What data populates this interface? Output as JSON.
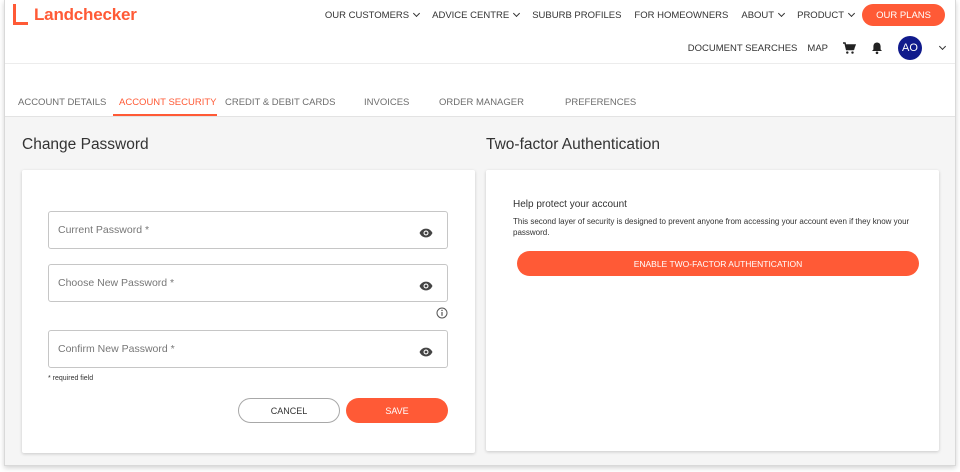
{
  "brand": {
    "name": "Landchecker",
    "accent": "#ff5a36",
    "avatar_bg": "#101a8c"
  },
  "topnav": {
    "items": [
      {
        "label": "OUR CUSTOMERS",
        "dropdown": true
      },
      {
        "label": "ADVICE CENTRE",
        "dropdown": true
      },
      {
        "label": "SUBURB PROFILES",
        "dropdown": false
      },
      {
        "label": "FOR HOMEOWNERS",
        "dropdown": false
      },
      {
        "label": "ABOUT",
        "dropdown": true
      },
      {
        "label": "PRODUCT",
        "dropdown": true
      }
    ],
    "cta": "OUR PLANS"
  },
  "subnav": {
    "document_searches": "DOCUMENT SEARCHES",
    "map": "MAP",
    "cart_icon": "cart-icon",
    "bell_icon": "bell-icon",
    "avatar_initials": "AO"
  },
  "tabs": [
    {
      "label": "ACCOUNT DETAILS",
      "active": false
    },
    {
      "label": "ACCOUNT SECURITY",
      "active": true
    },
    {
      "label": "CREDIT & DEBIT CARDS",
      "active": false
    },
    {
      "label": "INVOICES",
      "active": false
    },
    {
      "label": "ORDER MANAGER",
      "active": false
    },
    {
      "label": "PREFERENCES",
      "active": false
    }
  ],
  "change_password": {
    "title": "Change Password",
    "current_placeholder": "Current Password *",
    "new_placeholder": "Choose New Password *",
    "confirm_placeholder": "Confirm New Password *",
    "required_note": "* required field",
    "cancel_label": "CANCEL",
    "save_label": "SAVE"
  },
  "two_factor": {
    "title": "Two-factor Authentication",
    "heading": "Help protect your account",
    "description": "This second layer of security is designed to prevent anyone from accessing your account even if they know your password.",
    "enable_label": "ENABLE TWO-FACTOR AUTHENTICATION"
  }
}
